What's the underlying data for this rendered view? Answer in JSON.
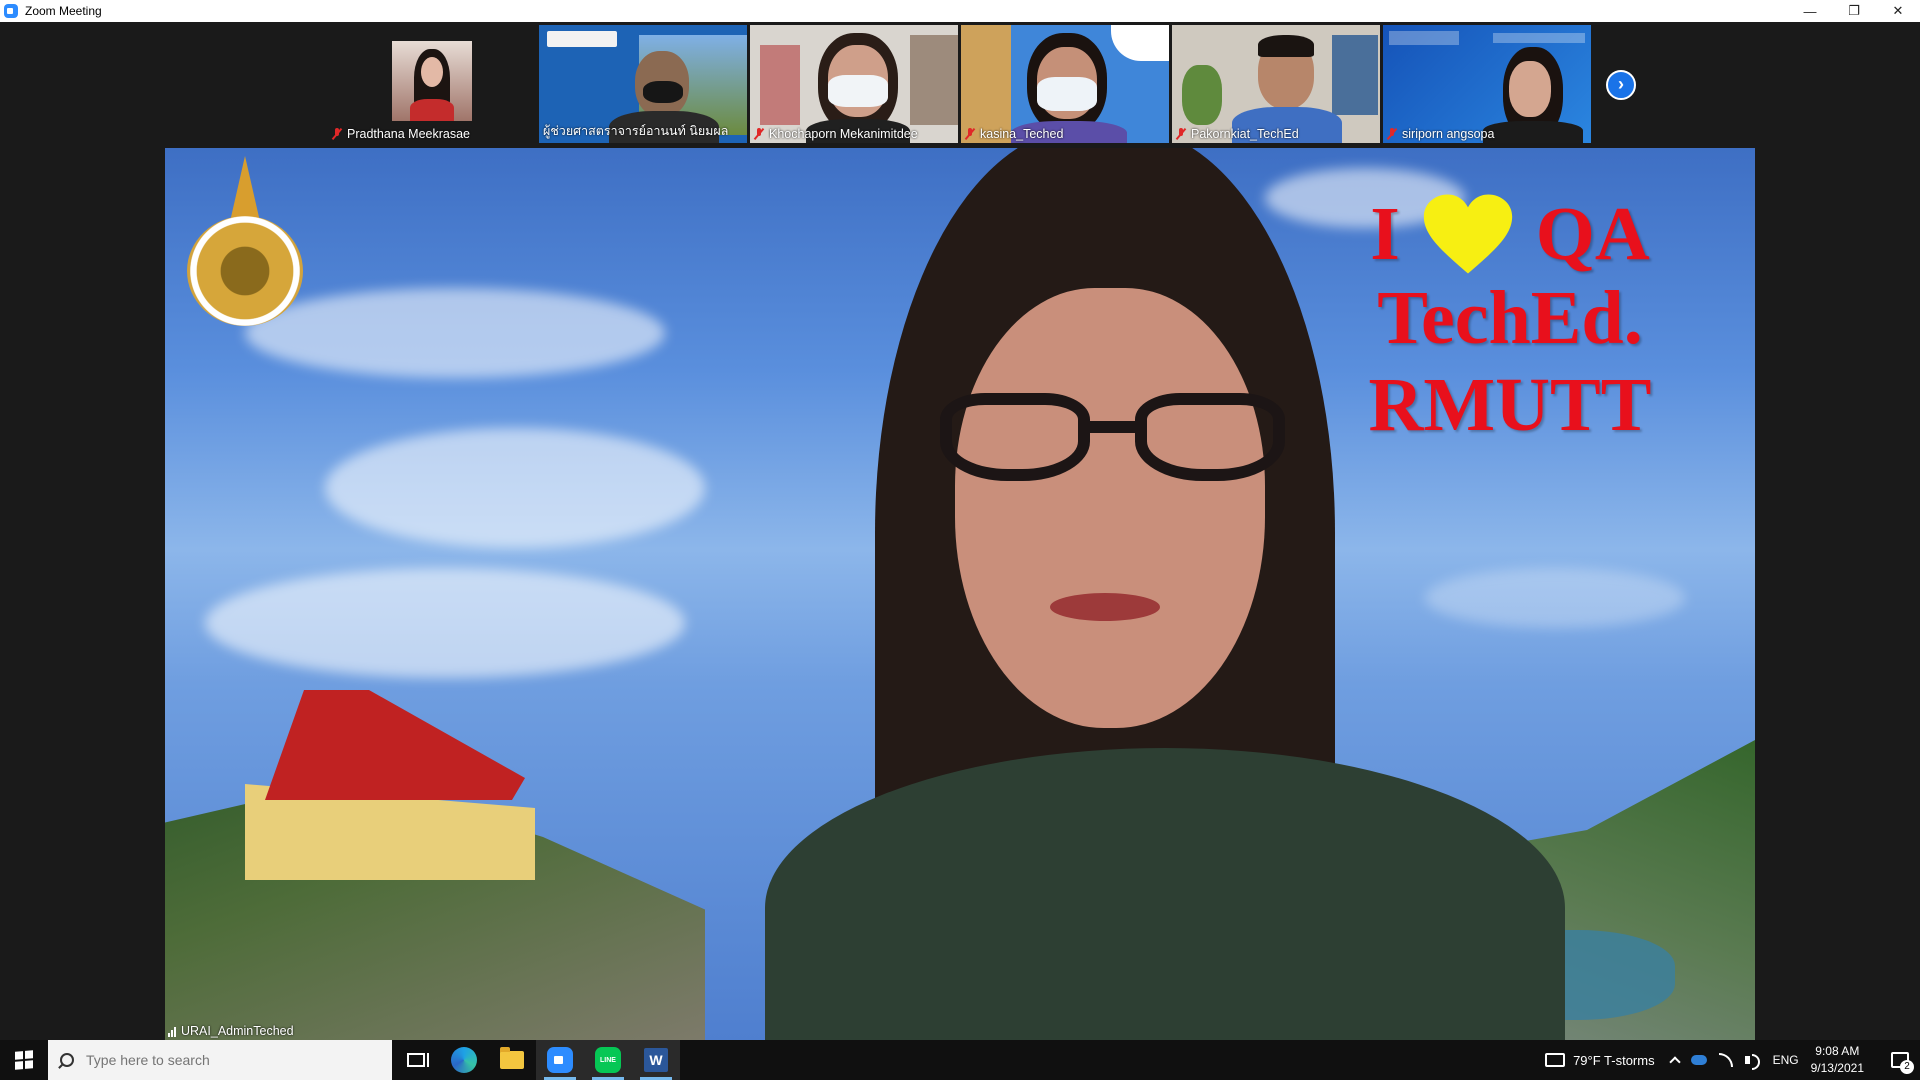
{
  "window": {
    "title": "Zoom Meeting",
    "minimize": "—",
    "restore": "❐",
    "close": "✕"
  },
  "gallery": {
    "participants": [
      {
        "name": "Pradthana Meekrasae",
        "muted": true,
        "bg": "#1f1f1f"
      },
      {
        "name": "ผู้ช่วยศาสตราจารย์อานนท์ นิยมผล",
        "muted": false,
        "bg": "#1d63b5"
      },
      {
        "name": "Khochaporn Mekanimitdee",
        "muted": true,
        "bg": "#d9d5cf"
      },
      {
        "name": "kasina_Teched",
        "muted": true,
        "bg": "#3f86d9"
      },
      {
        "name": "Pakornkiat_TechEd",
        "muted": true,
        "bg": "#cfc9bf"
      },
      {
        "name": "siriporn angsopa",
        "muted": true,
        "bg": "#1553b8"
      }
    ],
    "next_icon": "›"
  },
  "main": {
    "speaker": "URAI_AdminTeched",
    "slogan": {
      "line1_left": "I",
      "line1_right": "QA",
      "line2": "TechEd.",
      "line3": "RMUTT"
    },
    "accent_red": "#e8101c",
    "heart_color": "#f7ef12"
  },
  "taskbar": {
    "search_placeholder": "Type here to search",
    "weather": "79°F  T-storms",
    "language": "ENG",
    "time": "9:08 AM",
    "date": "9/13/2021",
    "notifications": "2"
  }
}
